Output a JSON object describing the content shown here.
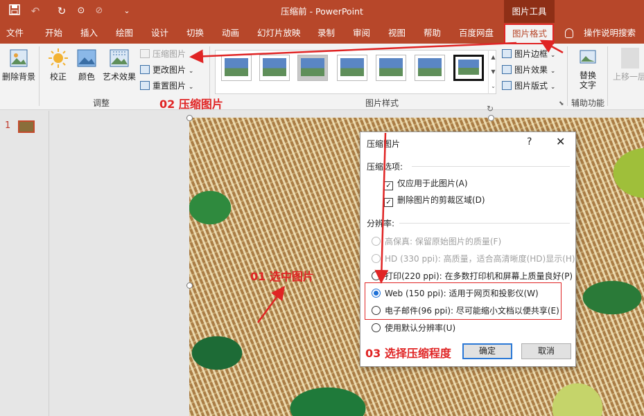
{
  "titlebar": {
    "title": "压缩前  -  PowerPoint",
    "context_tab": "图片工具",
    "save_icon": "save-icon",
    "undo_icon": "undo-icon",
    "redo_icon": "redo-icon"
  },
  "tabs": [
    "文件",
    "开始",
    "插入",
    "绘图",
    "设计",
    "切换",
    "动画",
    "幻灯片放映",
    "录制",
    "审阅",
    "视图",
    "帮助",
    "百度网盘",
    "图片格式"
  ],
  "help_search": "操作说明搜索",
  "ribbon": {
    "remove_bg": "删除背景",
    "corrections": "校正",
    "color": "颜色",
    "artistic": "艺术效果",
    "compress": "压缩图片",
    "change_picture": "更改图片",
    "reset_picture": "重置图片",
    "adjust_group": "调整",
    "styles_group": "图片样式",
    "picture_border": "图片边框",
    "picture_effects": "图片效果",
    "picture_layout": "图片版式",
    "alt_text": "替换文字",
    "bring_forward": "上移一层",
    "accessibility_group": "辅助功能"
  },
  "slides_panel": {
    "slide_number": "1"
  },
  "dialog": {
    "title": "压缩图片",
    "help": "?",
    "close": "✕",
    "compression_options_label": "压缩选项:",
    "apply_only_this": "仅应用于此图片(A)",
    "delete_cropped": "删除图片的剪裁区域(D)",
    "resolution_label": "分辨率:",
    "options": [
      {
        "label": "高保真: 保留原始图片的质量(F)",
        "enabled": false,
        "selected": false
      },
      {
        "label": "HD (330 ppi): 高质量，适合高清晰度(HD)显示(H)",
        "enabled": false,
        "selected": false
      },
      {
        "label": "打印(220 ppi): 在多数打印机和屏幕上质量良好(P)",
        "enabled": true,
        "selected": false
      },
      {
        "label": "Web (150 ppi): 适用于网页和投影仪(W)",
        "enabled": true,
        "selected": true
      },
      {
        "label": "电子邮件(96 ppi): 尽可能缩小文档以便共享(E)",
        "enabled": true,
        "selected": false
      },
      {
        "label": "使用默认分辨率(U)",
        "enabled": true,
        "selected": false
      }
    ],
    "ok": "确定",
    "cancel": "取消"
  },
  "annotations": {
    "step1": "01 选中图片",
    "step2": "02 压缩图片",
    "step3": "03 选择压缩程度"
  },
  "colors": {
    "accent": "#b7472a",
    "annotation": "#e02424",
    "radio_selected": "#1c6fd6"
  }
}
